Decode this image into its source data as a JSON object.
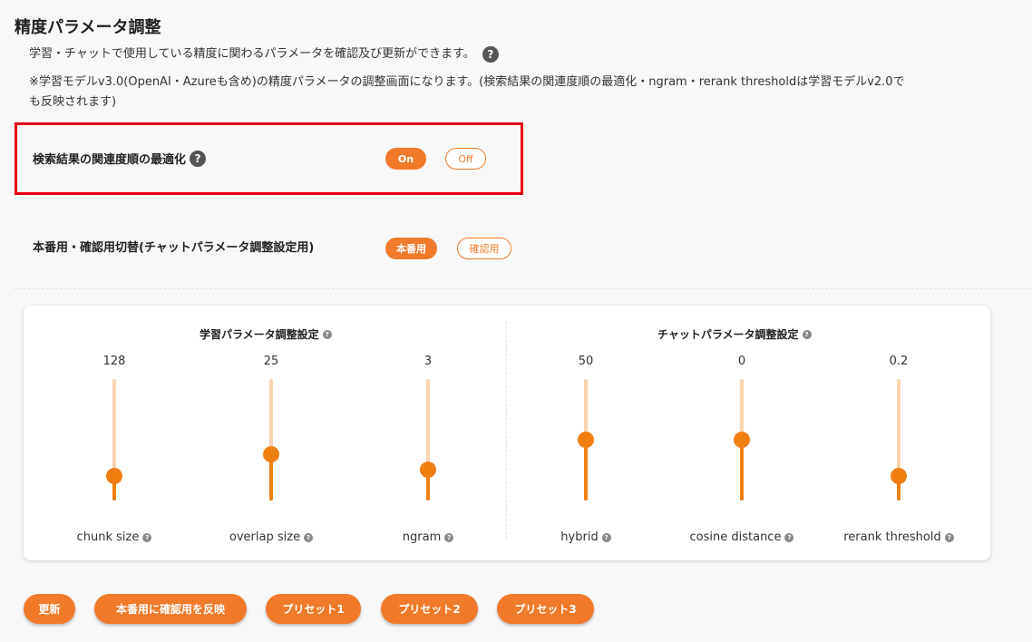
{
  "page": {
    "title": "精度パラメータ調整",
    "description1": "学習・チャットで使用している精度に関わるパラメータを確認及び更新ができます。",
    "description2": "※学習モデルv3.0(OpenAI・Azureも含め)の精度パラメータの調整画面になります。(検索結果の関連度順の最適化・ngram・rerank thresholdは学習モデルv2.0でも反映されます)",
    "help_glyph": "?"
  },
  "relevance_opt": {
    "label": "検索結果の関連度順の最適化",
    "on_label": "On",
    "off_label": "Off",
    "selected": "On"
  },
  "env_switch": {
    "label": "本番用・確認用切替(チャットパラメータ調整設定用)",
    "prod_label": "本番用",
    "test_label": "確認用",
    "selected": "本番用"
  },
  "learning_params": {
    "title": "学習パラメータ調整設定",
    "sliders": [
      {
        "name": "chunk size",
        "value": "128",
        "level": 0.2
      },
      {
        "name": "overlap size",
        "value": "25",
        "level": 0.38
      },
      {
        "name": "ngram",
        "value": "3",
        "level": 0.25
      }
    ]
  },
  "chat_params": {
    "title": "チャットパラメータ調整設定",
    "sliders": [
      {
        "name": "hybrid",
        "value": "50",
        "level": 0.5
      },
      {
        "name": "cosine distance",
        "value": "0",
        "level": 0.5
      },
      {
        "name": "rerank threshold",
        "value": "0.2",
        "level": 0.2
      }
    ]
  },
  "actions": {
    "update": "更新",
    "apply": "本番用に確認用を反映",
    "preset1": "プリセット1",
    "preset2": "プリセット2",
    "preset3": "プリセット3"
  },
  "colors": {
    "accent": "#f07a2a",
    "slider_fill": "#f07f12",
    "slider_track": "#f9d4b0",
    "highlight": "#e60012"
  }
}
